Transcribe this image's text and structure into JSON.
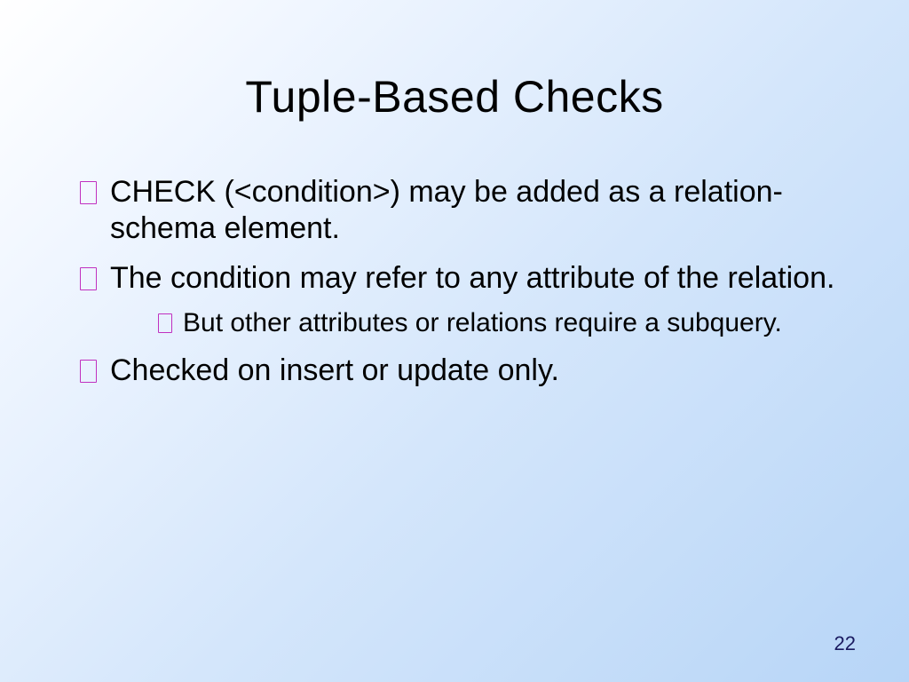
{
  "slide": {
    "title": "Tuple-Based Checks",
    "bullets": [
      {
        "text": "CHECK (<condition>) may be added as a relation-schema element."
      },
      {
        "text": "The condition may refer to any attribute of the relation.",
        "sub": [
          {
            "text": "But other attributes or relations require a subquery."
          }
        ]
      },
      {
        "text": "Checked on insert or update only."
      }
    ],
    "page_number": "22"
  }
}
